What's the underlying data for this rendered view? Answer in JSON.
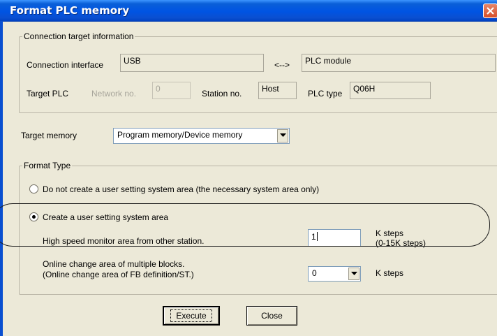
{
  "window": {
    "title": "Format PLC memory"
  },
  "connection": {
    "legend": "Connection target information",
    "interface_label": "Connection interface",
    "interface_value": "USB",
    "arrow": "<-->",
    "module_value": "PLC module",
    "target_plc_label": "Target PLC",
    "network_label": "Network no.",
    "network_value": "0",
    "station_label": "Station no.",
    "station_value": "Host",
    "plc_type_label": "PLC type",
    "plc_type_value": "Q06H"
  },
  "target_memory": {
    "label": "Target memory",
    "selected": "Program memory/Device memory"
  },
  "format_type": {
    "legend": "Format Type",
    "option1_label": "Do not create a user setting system area (the necessary system area only)",
    "option2_label": "Create a user setting system area",
    "selected_option": 2,
    "hs_monitor_label": "High speed monitor area from other station.",
    "hs_monitor_value": "1",
    "hs_unit_line1": "K steps",
    "hs_unit_line2": "(0-15K steps)",
    "online_change_line1": "Online change area of multiple blocks.",
    "online_change_line2": "(Online change area of FB definition/ST.)",
    "online_change_value": "0",
    "online_change_unit": "K steps"
  },
  "buttons": {
    "execute": "Execute",
    "close": "Close"
  },
  "colors": {
    "titlebar": "#0054e3",
    "dialog_bg": "#ece9d8",
    "close_button": "#d64f2a"
  },
  "icons": {
    "close": "close-icon",
    "dropdown": "chevron-down-icon"
  }
}
